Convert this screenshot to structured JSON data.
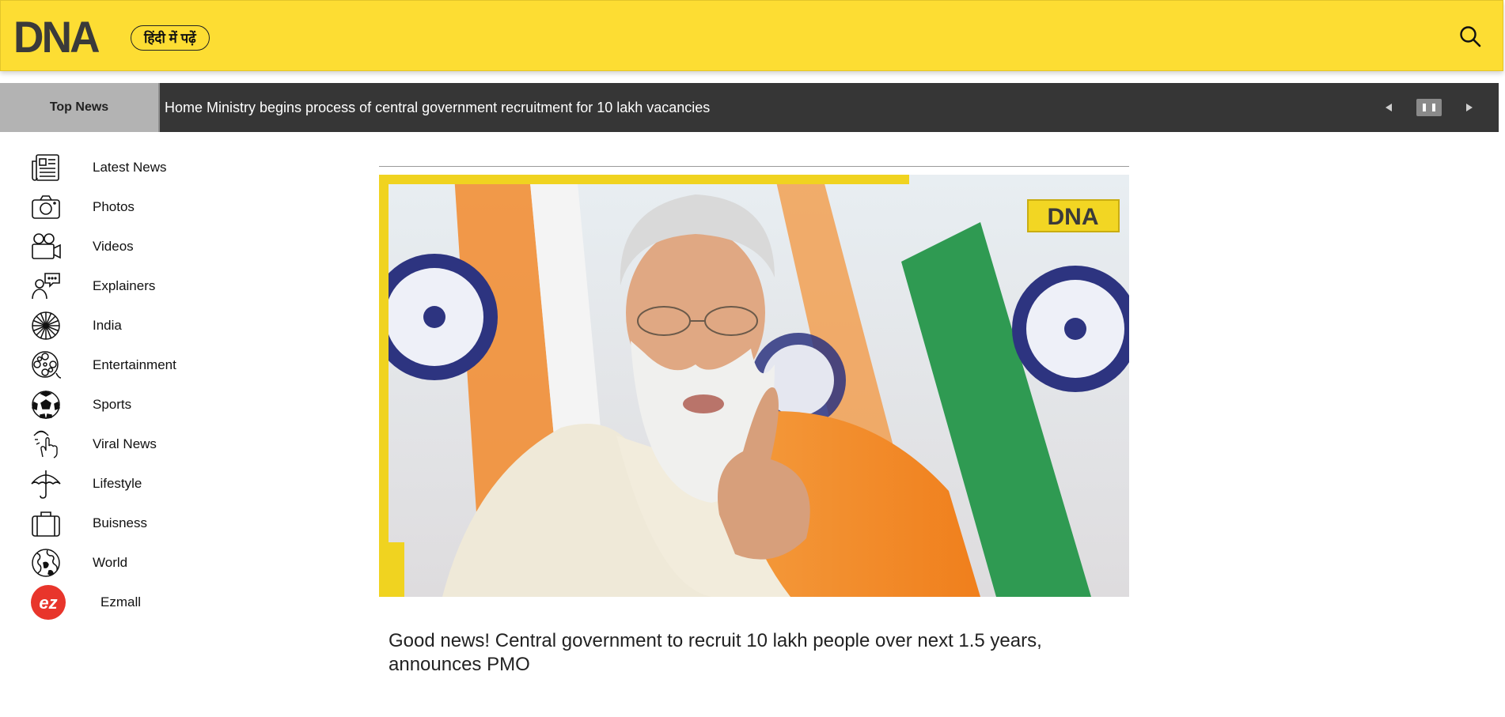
{
  "header": {
    "logo_text": "DNA",
    "hindi_button": "हिंदी में पढ़ें",
    "search_icon": "search-icon",
    "bg_color": "#fddd33"
  },
  "ticker": {
    "label": "Top News",
    "headline": "Home Ministry begins process of central government recruitment for 10 lakh vacancies",
    "controls": [
      "prev-icon",
      "pause-icon",
      "next-icon"
    ]
  },
  "sidebar": {
    "items": [
      {
        "label": "Latest News",
        "icon": "newspaper-icon"
      },
      {
        "label": "Photos",
        "icon": "camera-icon"
      },
      {
        "label": "Videos",
        "icon": "video-camera-icon"
      },
      {
        "label": "Explainers",
        "icon": "explainer-icon"
      },
      {
        "label": "India",
        "icon": "ashoka-chakra-icon"
      },
      {
        "label": "Entertainment",
        "icon": "film-reel-icon"
      },
      {
        "label": "Sports",
        "icon": "football-icon"
      },
      {
        "label": "Viral News",
        "icon": "viral-touch-icon"
      },
      {
        "label": "Lifestyle",
        "icon": "umbrella-icon"
      },
      {
        "label": "Buisness",
        "icon": "briefcase-icon"
      },
      {
        "label": "World",
        "icon": "globe-icon"
      },
      {
        "label": "Ezmall",
        "icon": "ezmall-logo-icon"
      }
    ]
  },
  "main": {
    "hero_badge": "DNA",
    "headline": "Good news! Central government to recruit 10 lakh people over next 1.5 years, announces PMO"
  },
  "colors": {
    "accent": "#fddd33",
    "ticker_bg": "#363636",
    "ticker_label_bg": "#b3b3b3"
  }
}
